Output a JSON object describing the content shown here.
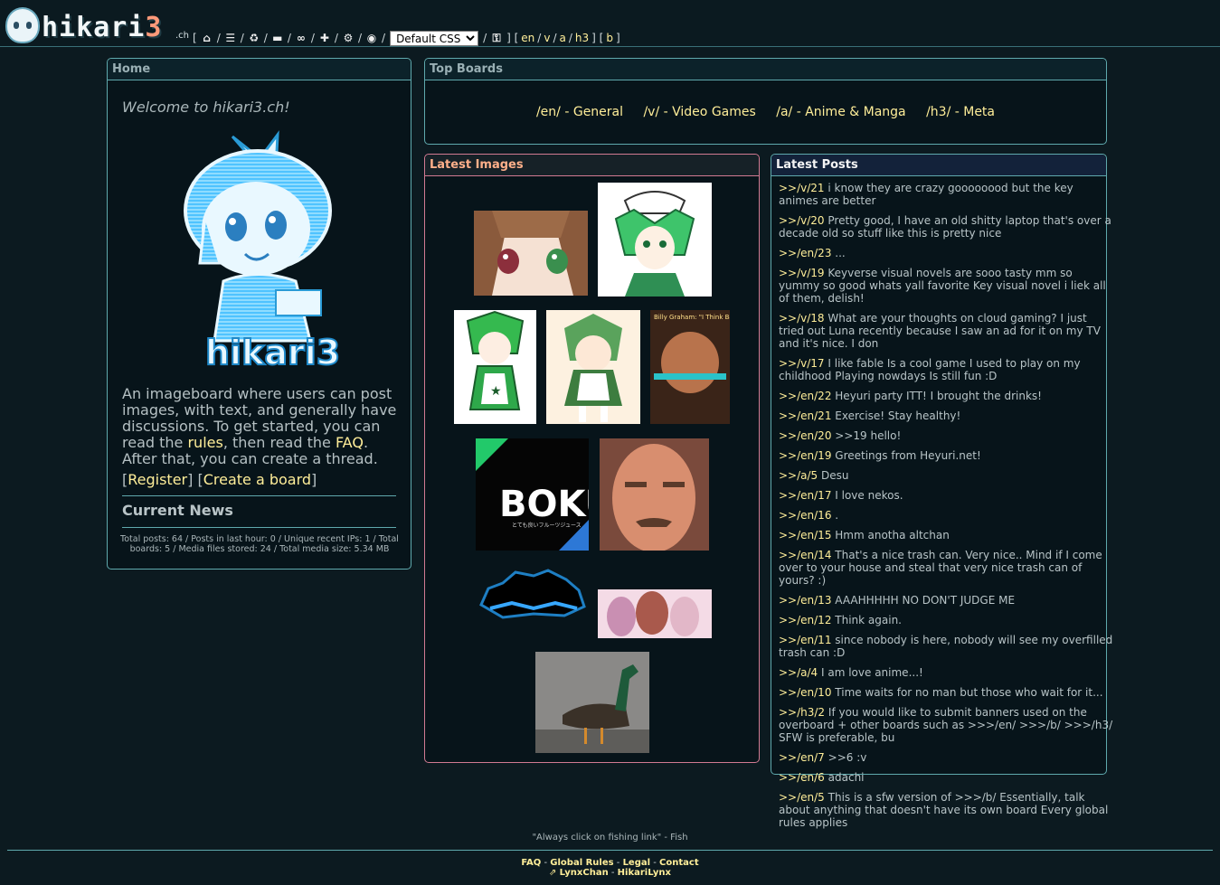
{
  "header": {
    "logo_text": "hikari",
    "logo_number": "3",
    "logo_suffix": ".ch",
    "style_select": "Default CSS",
    "boards": [
      "en",
      "v",
      "a",
      "h3"
    ],
    "extra_board": "b",
    "icons": [
      "home-icon",
      "list-icon",
      "recycle-icon",
      "briefcase-icon",
      "infinity-icon",
      "plus-icon",
      "gear-icon",
      "eye-icon",
      "key-icon"
    ]
  },
  "home": {
    "title": "Home",
    "welcome": "Welcome to hikari3.ch!",
    "mascot_caption": "hikari3",
    "desc_pre": "An imageboard where users can post images, with text, and generally have discussions. To get started, you can read the ",
    "rules_link": "rules",
    "desc_mid": ", then read the ",
    "faq_link": "FAQ",
    "desc_post": ". After that, you can create a thread.",
    "register_link": "Register",
    "create_board_link": "Create a board",
    "news_title": "Current News",
    "stats": "Total posts: 64 / Posts in last hour: 0 / Unique recent IPs: 1 / Total boards: 5 / Media files stored: 24 / Total media size: 5.34 MB"
  },
  "top_boards": {
    "title": "Top Boards",
    "items": [
      {
        "label": "/en/ - General"
      },
      {
        "label": "/v/ - Video Games"
      },
      {
        "label": "/a/ - Anime & Manga"
      },
      {
        "label": "/h3/ - Meta"
      }
    ]
  },
  "latest_images": {
    "title": "Latest Images",
    "thumb_text": {
      "billy": "Billy Graham: \"I Think Backlund Is Queer For My Bros\"",
      "boku": "BOKU",
      "boku_sub": "とても良いフルーツジュース"
    },
    "colors": {
      "accent": "#d17a92",
      "title": "#ffb08a"
    }
  },
  "latest_posts": {
    "title": "Latest Posts",
    "items": [
      {
        "ref": ">>/v/21",
        "text": "i know they are crazy goooooood but the key animes are better"
      },
      {
        "ref": ">>/v/20",
        "text": "Pretty good, I have an old shitty laptop that's over a decade old so stuff like this is pretty nice"
      },
      {
        "ref": ">>/en/23",
        "text": "..."
      },
      {
        "ref": ">>/v/19",
        "text": "Keyverse visual novels are sooo tasty mm so yummy so good whats yall favorite Key visual novel i liek all of them, delish!"
      },
      {
        "ref": ">>/v/18",
        "text": "What are your thoughts on cloud gaming? I just tried out Luna recently because I saw an ad for it on my TV and it's nice. I don"
      },
      {
        "ref": ">>/v/17",
        "text": "I like fable Is a cool game I used to play on my childhood Playing nowdays Is still fun :D"
      },
      {
        "ref": ">>/en/22",
        "text": "Heyuri party ITT! I brought the drinks!"
      },
      {
        "ref": ">>/en/21",
        "text": "Exercise! Stay healthy!"
      },
      {
        "ref": ">>/en/20",
        "text": ">>19 hello!"
      },
      {
        "ref": ">>/en/19",
        "text": "Greetings from Heyuri.net!"
      },
      {
        "ref": ">>/a/5",
        "text": "Desu"
      },
      {
        "ref": ">>/en/17",
        "text": "I love nekos."
      },
      {
        "ref": ">>/en/16",
        "text": "."
      },
      {
        "ref": ">>/en/15",
        "text": "Hmm anotha altchan"
      },
      {
        "ref": ">>/en/14",
        "text": "That's a nice trash can. Very nice.. Mind if I come over to your house and steal that very nice trash can of yours? :)"
      },
      {
        "ref": ">>/en/13",
        "text": "AAAHHHHH NO DON'T JUDGE ME"
      },
      {
        "ref": ">>/en/12",
        "text": "Think again."
      },
      {
        "ref": ">>/en/11",
        "text": "since nobody is here, nobody will see my overfilled trash can :D"
      },
      {
        "ref": ">>/a/4",
        "text": "I am love anime...!"
      },
      {
        "ref": ">>/en/10",
        "text": "Time waits for no man but those who wait for it..."
      },
      {
        "ref": ">>/h3/2",
        "text": "If you would like to submit banners used on the overboard + other boards such as >>>/en/ >>>/b/ >>>/h3/ SFW is preferable, bu"
      },
      {
        "ref": ">>/en/7",
        "text": ">>6 :v"
      },
      {
        "ref": ">>/en/6",
        "text": "adachi"
      },
      {
        "ref": ">>/en/5",
        "text": "This is a sfw version of >>>/b/ Essentially, talk about anything that doesn't have its own board Every global rules applies"
      }
    ]
  },
  "footer": {
    "quote": "\"Always click on fishing link\" - Fish",
    "links_row1": [
      "FAQ",
      "Global Rules",
      "Legal",
      "Contact"
    ],
    "links_row2": [
      "LynxChan",
      "HikariLynx"
    ],
    "separator": " - "
  }
}
